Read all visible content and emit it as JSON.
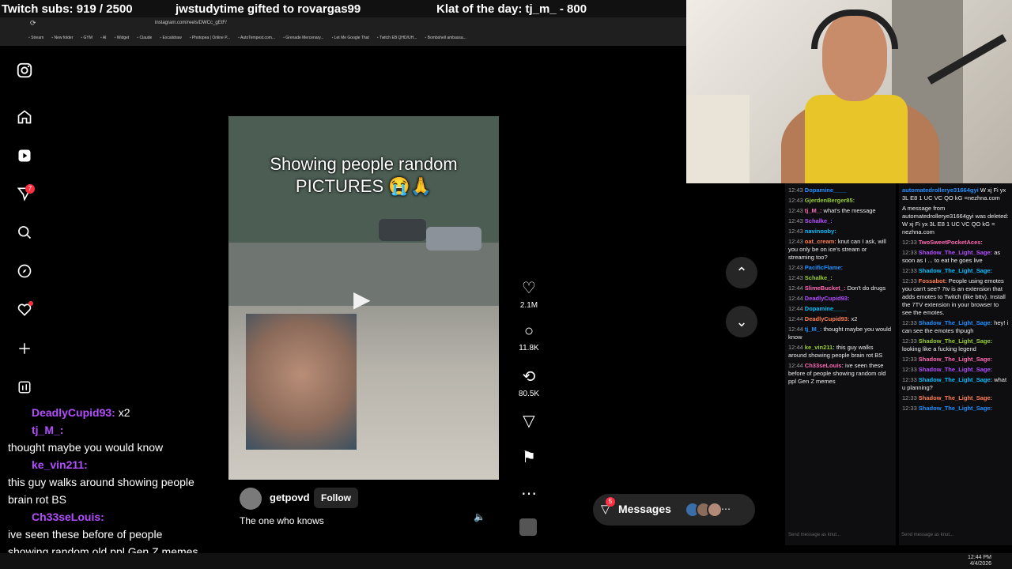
{
  "overlay": {
    "subs": "Twitch subs: 919 / 2500",
    "gifted": "jwstudytime gifted to rovargas99",
    "klat": "Klat of the day: tj_m_ - 800"
  },
  "browser": {
    "url": "instagram.com/reels/DWCc_gEtF/",
    "bookmarks": [
      "Stream",
      "New folder",
      "GYM",
      "AI",
      "Widget",
      "Claude",
      "Excalidraw",
      "Photopea | Online P...",
      "AutoTempest.com...",
      "Grenade Mercenary...",
      "Let Me Google That",
      "Twitch EB QHD/UH...",
      "Bombshell ambassa..."
    ]
  },
  "nav": {
    "notifications_badge": "7",
    "icons": [
      "instagram-icon",
      "home-icon",
      "reels-icon",
      "direct-icon",
      "search-icon",
      "explore-icon",
      "activity-icon",
      "create-icon",
      "dashboard-icon"
    ]
  },
  "reel": {
    "caption": "Showing people random\nPICTURES 😭🙏",
    "username": "getpovd",
    "follow": "Follow",
    "description": "The one who knows",
    "likes": "2.1M",
    "comments": "11.8K",
    "reposts": "80.5K"
  },
  "messages": {
    "label": "Messages",
    "badge": "5"
  },
  "overlay_chat": [
    {
      "user": "DeadlyCupid93:",
      "text": "x2"
    },
    {
      "user": "tj_M_:",
      "text": ""
    },
    {
      "user": "",
      "text": "thought maybe you would know"
    },
    {
      "user": "ke_vin211:",
      "text": ""
    },
    {
      "user": "",
      "text": "this guy walks around showing people"
    },
    {
      "user": "",
      "text": "brain rot BS"
    },
    {
      "user": "Ch33seLouis:",
      "text": ""
    },
    {
      "user": "",
      "text": "ive seen these before of people"
    },
    {
      "user": "",
      "text": "showing random old ppl Gen Z memes"
    }
  ],
  "chat_a": [
    {
      "ts": "12:43",
      "user": "Dopamine____",
      "text": ""
    },
    {
      "ts": "12:43",
      "user": "GjerdenBerger85:",
      "text": ""
    },
    {
      "ts": "12:43",
      "user": "tj_M_:",
      "text": "what's the message"
    },
    {
      "ts": "12:43",
      "user": "Schalke_:",
      "text": ""
    },
    {
      "ts": "12:43",
      "user": "navinooby:",
      "text": ""
    },
    {
      "ts": "12:43",
      "user": "oat_cream:",
      "text": "knut can I ask, will you only be on ice's stream or streaming too?"
    },
    {
      "ts": "12:43",
      "user": "PacificFlame:",
      "text": ""
    },
    {
      "ts": "12:43",
      "user": "Schalke_:",
      "text": ""
    },
    {
      "ts": "12:44",
      "user": "SlimeBucket_:",
      "text": "Don't do drugs"
    },
    {
      "ts": "12:44",
      "user": "DeadlyCupid93:",
      "text": ""
    },
    {
      "ts": "12:44",
      "user": "Dopamine____",
      "text": ""
    },
    {
      "ts": "12:44",
      "user": "DeadlyCupid93:",
      "text": "x2"
    },
    {
      "ts": "12:44",
      "user": "tj_M_:",
      "text": "thought maybe you would know"
    },
    {
      "ts": "12:44",
      "user": "ke_vin211:",
      "text": "this guy walks around showing people brain rot BS"
    },
    {
      "ts": "12:44",
      "user": "Ch33seLouis:",
      "text": "ive seen these before of people showing random old ppl Gen Z memes"
    }
  ],
  "chat_a_input": "Send message as knut...",
  "chat_b": [
    {
      "ts": "",
      "user": "automatedrolleryе31664gyi",
      "text": "W xj Fi yx 3L E8 1 UC VC QO kG =nezhna.com"
    },
    {
      "ts": "",
      "user": "",
      "text": "A message from automatedrolleryе31664gyi was deleted: W xj Fi yx 3L E8 1 UC VC QO kG = nezhna.com"
    },
    {
      "ts": "12:33",
      "user": "TwoSweetPocketAces:",
      "text": ""
    },
    {
      "ts": "12:33",
      "user": "Shadow_The_Light_Sage:",
      "text": "as soon as I ... to eat he goes live"
    },
    {
      "ts": "12:33",
      "user": "Shadow_The_Light_Sage:",
      "text": ""
    },
    {
      "ts": "12:33",
      "user": "Fossabot:",
      "text": "People using emotes you can't see? 7tv is an extension that adds emotes to Twitch (like bttv). Install the 7TV extension in your browser to see the emotes."
    },
    {
      "ts": "12:33",
      "user": "Shadow_The_Light_Sage:",
      "text": "hey! i can see the emotes thpugh"
    },
    {
      "ts": "12:33",
      "user": "Shadow_The_Light_Sage:",
      "text": "looking like a fucking legend"
    },
    {
      "ts": "12:33",
      "user": "Shadow_The_Light_Sage:",
      "text": ""
    },
    {
      "ts": "12:33",
      "user": "Shadow_The_Light_Sage:",
      "text": ""
    },
    {
      "ts": "12:33",
      "user": "Shadow_The_Light_Sage:",
      "text": "what u planning?"
    },
    {
      "ts": "12:33",
      "user": "Shadow_The_Light_Sage:",
      "text": ""
    },
    {
      "ts": "12:33",
      "user": "Shadow_The_Light_Sage:",
      "text": ""
    }
  ],
  "chat_b_input": "Send message as knut...",
  "taskbar": {
    "time": "12:44 PM",
    "date": "4/4/2026"
  }
}
